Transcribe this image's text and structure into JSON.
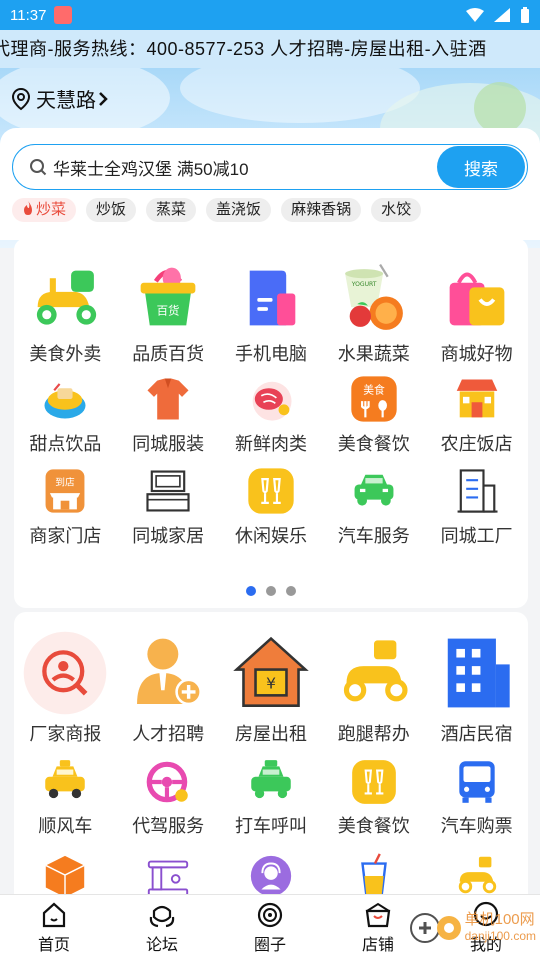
{
  "status": {
    "time": "11:37"
  },
  "marquee": {
    "text": "代理商-服务热线：400-8577-253 人才招聘-房屋出租-入驻酒"
  },
  "location": {
    "name": "天慧路"
  },
  "search": {
    "value": "华莱士全鸡汉堡 满50减10",
    "button": "搜索"
  },
  "tags": [
    "炒菜",
    "炒饭",
    "蒸菜",
    "盖浇饭",
    "麻辣香锅",
    "水饺"
  ],
  "grid1": [
    [
      {
        "label": "美食外卖",
        "icon": "scooter-icon"
      },
      {
        "label": "品质百货",
        "icon": "shopping-basket-icon",
        "badge": "百货"
      },
      {
        "label": "手机电脑",
        "icon": "devices-icon"
      },
      {
        "label": "水果蔬菜",
        "icon": "fruit-icon",
        "badge": "YOGURT"
      },
      {
        "label": "商城好物",
        "icon": "shopping-bag-icon"
      }
    ],
    [
      {
        "label": "甜点饮品",
        "icon": "dessert-icon"
      },
      {
        "label": "同城服装",
        "icon": "shirt-icon"
      },
      {
        "label": "新鲜肉类",
        "icon": "meat-icon"
      },
      {
        "label": "美食餐饮",
        "icon": "dining-icon",
        "badge": "美食"
      },
      {
        "label": "农庄饭店",
        "icon": "shop-icon"
      }
    ],
    [
      {
        "label": "商家门店",
        "icon": "store-icon",
        "badge": "到店"
      },
      {
        "label": "同城家居",
        "icon": "furniture-icon"
      },
      {
        "label": "休闲娱乐",
        "icon": "cheers-icon"
      },
      {
        "label": "汽车服务",
        "icon": "car-icon"
      },
      {
        "label": "同城工厂",
        "icon": "building-icon"
      }
    ]
  ],
  "grid2": [
    [
      {
        "label": "厂家商报",
        "icon": "factory-news-icon"
      },
      {
        "label": "人才招聘",
        "icon": "recruit-icon"
      },
      {
        "label": "房屋出租",
        "icon": "house-icon"
      },
      {
        "label": "跑腿帮办",
        "icon": "errand-icon"
      },
      {
        "label": "酒店民宿",
        "icon": "hotel-icon"
      }
    ],
    [
      {
        "label": "顺风车",
        "icon": "taxi-icon"
      },
      {
        "label": "代驾服务",
        "icon": "steering-wheel-icon"
      },
      {
        "label": "打车呼叫",
        "icon": "call-car-icon"
      },
      {
        "label": "美食餐饮",
        "icon": "cheers-icon"
      },
      {
        "label": "汽车购票",
        "icon": "bus-icon"
      }
    ],
    [
      {
        "label": "",
        "icon": "box-icon"
      },
      {
        "label": "",
        "icon": "sewing-icon"
      },
      {
        "label": "",
        "icon": "support-icon"
      },
      {
        "label": "",
        "icon": "drink-icon"
      },
      {
        "label": "",
        "icon": "delivery-icon"
      }
    ]
  ],
  "pager": {
    "pages": 3,
    "current": 1
  },
  "tabbar": [
    {
      "label": "首页",
      "icon": "home-icon"
    },
    {
      "label": "论坛",
      "icon": "forum-icon"
    },
    {
      "label": "圈子",
      "icon": "circle-icon"
    },
    {
      "label": "店铺",
      "icon": "shop-icon"
    },
    {
      "label": "我的",
      "icon": "profile-icon"
    }
  ],
  "watermark": {
    "line1": "单机100网",
    "line2": "danji100.com"
  },
  "colors": {
    "primary": "#1ea1f1",
    "hot": "#e94b3c",
    "dot_active": "#2b6cf0"
  }
}
